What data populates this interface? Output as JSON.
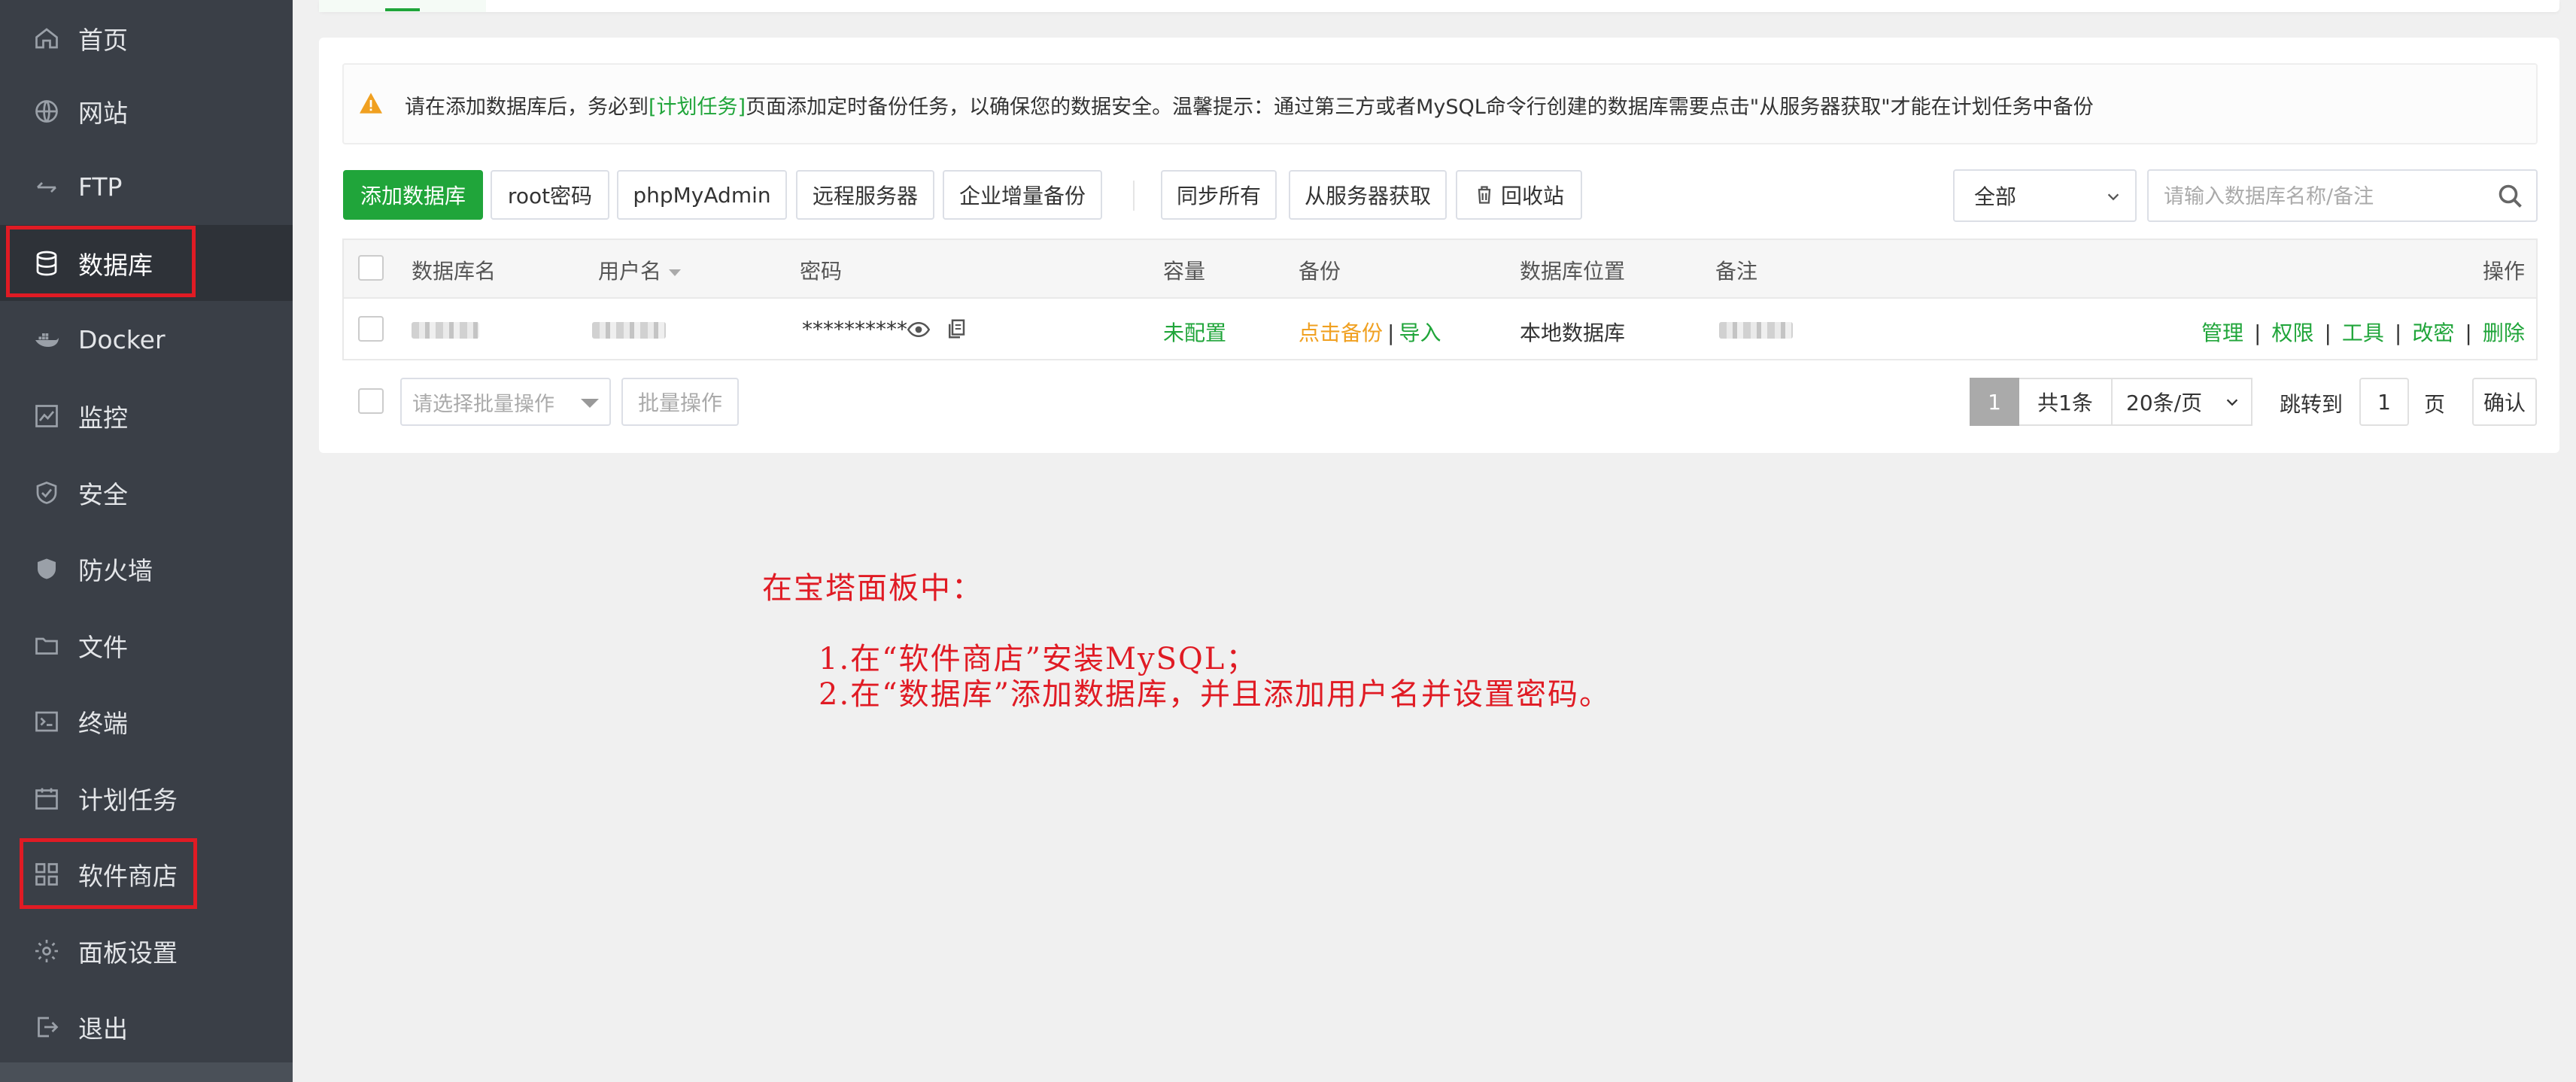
{
  "sidebar": {
    "items": [
      {
        "label": "首页",
        "icon": "home-icon"
      },
      {
        "label": "网站",
        "icon": "globe-icon"
      },
      {
        "label": "FTP",
        "icon": "ftp-icon"
      },
      {
        "label": "数据库",
        "icon": "database-icon",
        "active": true
      },
      {
        "label": "Docker",
        "icon": "docker-icon"
      },
      {
        "label": "监控",
        "icon": "monitor-icon"
      },
      {
        "label": "安全",
        "icon": "shield-check-icon"
      },
      {
        "label": "防火墙",
        "icon": "firewall-icon"
      },
      {
        "label": "文件",
        "icon": "folder-icon"
      },
      {
        "label": "终端",
        "icon": "terminal-icon"
      },
      {
        "label": "计划任务",
        "icon": "calendar-icon"
      },
      {
        "label": "软件商店",
        "icon": "apps-grid-icon"
      },
      {
        "label": "面板设置",
        "icon": "gear-icon"
      },
      {
        "label": "退出",
        "icon": "logout-icon"
      }
    ]
  },
  "alert": {
    "before": "请在添加数据库后，务必到",
    "link": "[计划任务]",
    "after": "页面添加定时备份任务，以确保您的数据安全。温馨提示：通过第三方或者MySQL命令行创建的数据库需要点击\"从服务器获取\"才能在计划任务中备份"
  },
  "toolbar": {
    "add_db": "添加数据库",
    "root_pwd": "root密码",
    "phpmyadmin": "phpMyAdmin",
    "remote_server": "远程服务器",
    "enterprise_backup": "企业增量备份",
    "sync_all": "同步所有",
    "fetch_from_server": "从服务器获取",
    "recycle_bin": "回收站",
    "filter_value": "全部",
    "search_placeholder": "请输入数据库名称/备注"
  },
  "table": {
    "headers": {
      "name": "数据库名",
      "user": "用户名",
      "password": "密码",
      "capacity": "容量",
      "backup": "备份",
      "location": "数据库位置",
      "remark": "备注",
      "actions": "操作"
    },
    "row": {
      "password": "**********",
      "capacity": "未配置",
      "backup_link": "点击备份",
      "import_link": "导入",
      "location": "本地数据库",
      "actions": [
        "管理",
        "权限",
        "工具",
        "改密",
        "删除"
      ]
    }
  },
  "footer": {
    "batch_placeholder": "请选择批量操作",
    "batch_button": "批量操作",
    "current_page": "1",
    "total": "共1条",
    "per_page": "20条/页",
    "jump_label": "跳转到",
    "jump_value": "1",
    "page_unit": "页",
    "confirm": "确认"
  },
  "annotation": {
    "title": "在宝塔面板中：",
    "line1": "1.在“软件商店”安装MySQL；",
    "line2": "2.在“数据库”添加数据库，并且添加用户名并设置密码。"
  },
  "colors": {
    "sidebar_bg": "#3a3f47",
    "accent_green": "#20a53a",
    "warning_orange": "#f0a020",
    "annotation_red": "#e01b24"
  }
}
